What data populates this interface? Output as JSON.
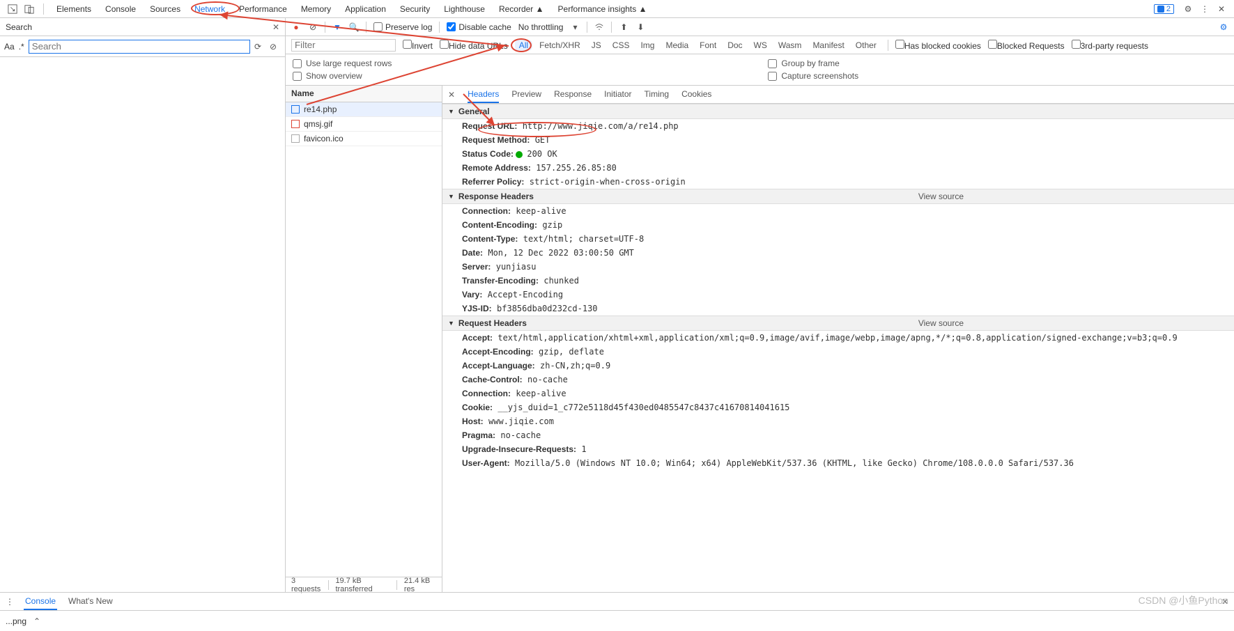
{
  "topTabs": {
    "items": [
      "Elements",
      "Console",
      "Sources",
      "Network",
      "Performance",
      "Memory",
      "Application",
      "Security",
      "Lighthouse",
      "Recorder ▲",
      "Performance insights ▲"
    ],
    "selected": "Network",
    "issuesBadge": "2"
  },
  "leftSearch": {
    "title": "Search",
    "placeholder": "Search",
    "aa": "Aa",
    "regex": ".*"
  },
  "toolbar": {
    "preserveLog": "Preserve log",
    "disableCache": "Disable cache",
    "throttling": "No throttling"
  },
  "filterBar": {
    "placeholder": "Filter",
    "invert": "Invert",
    "hideData": "Hide data URLs",
    "chips": [
      "All",
      "Fetch/XHR",
      "JS",
      "CSS",
      "Img",
      "Media",
      "Font",
      "Doc",
      "WS",
      "Wasm",
      "Manifest",
      "Other"
    ],
    "selected": "All",
    "blockedCookies": "Has blocked cookies",
    "blockedReq": "Blocked Requests",
    "thirdParty": "3rd-party requests"
  },
  "checkrow": {
    "largeRows": "Use large request rows",
    "overview": "Show overview",
    "groupFrame": "Group by frame",
    "capture": "Capture screenshots"
  },
  "reqlist": {
    "header": "Name",
    "items": [
      {
        "name": "re14.php",
        "type": "doc",
        "selected": true
      },
      {
        "name": "qmsj.gif",
        "type": "img",
        "selected": false
      },
      {
        "name": "favicon.ico",
        "type": "other",
        "selected": false
      }
    ]
  },
  "status": {
    "requests": "3 requests",
    "transferred": "19.7 kB transferred",
    "resources": "21.4 kB res"
  },
  "detailTabs": {
    "items": [
      "Headers",
      "Preview",
      "Response",
      "Initiator",
      "Timing",
      "Cookies"
    ],
    "selected": "Headers"
  },
  "general": {
    "title": "General",
    "rows": [
      {
        "k": "Request URL:",
        "v": "http://www.jiqie.com/a/re14.php"
      },
      {
        "k": "Request Method:",
        "v": "GET"
      },
      {
        "k": "Status Code:",
        "v": "200 OK",
        "dot": true
      },
      {
        "k": "Remote Address:",
        "v": "157.255.26.85:80"
      },
      {
        "k": "Referrer Policy:",
        "v": "strict-origin-when-cross-origin"
      }
    ]
  },
  "response": {
    "title": "Response Headers",
    "viewSource": "View source",
    "rows": [
      {
        "k": "Connection:",
        "v": "keep-alive"
      },
      {
        "k": "Content-Encoding:",
        "v": "gzip"
      },
      {
        "k": "Content-Type:",
        "v": "text/html; charset=UTF-8"
      },
      {
        "k": "Date:",
        "v": "Mon, 12 Dec 2022 03:00:50 GMT"
      },
      {
        "k": "Server:",
        "v": "yunjiasu"
      },
      {
        "k": "Transfer-Encoding:",
        "v": "chunked"
      },
      {
        "k": "Vary:",
        "v": "Accept-Encoding"
      },
      {
        "k": "YJS-ID:",
        "v": "bf3856dba0d232cd-130"
      }
    ]
  },
  "request": {
    "title": "Request Headers",
    "viewSource": "View source",
    "rows": [
      {
        "k": "Accept:",
        "v": "text/html,application/xhtml+xml,application/xml;q=0.9,image/avif,image/webp,image/apng,*/*;q=0.8,application/signed-exchange;v=b3;q=0.9"
      },
      {
        "k": "Accept-Encoding:",
        "v": "gzip, deflate"
      },
      {
        "k": "Accept-Language:",
        "v": "zh-CN,zh;q=0.9"
      },
      {
        "k": "Cache-Control:",
        "v": "no-cache"
      },
      {
        "k": "Connection:",
        "v": "keep-alive"
      },
      {
        "k": "Cookie:",
        "v": "__yjs_duid=1_c772e5118d45f430ed0485547c8437c41670814041615"
      },
      {
        "k": "Host:",
        "v": "www.jiqie.com"
      },
      {
        "k": "Pragma:",
        "v": "no-cache"
      },
      {
        "k": "Upgrade-Insecure-Requests:",
        "v": "1"
      },
      {
        "k": "User-Agent:",
        "v": "Mozilla/5.0 (Windows NT 10.0; Win64; x64) AppleWebKit/537.36 (KHTML, like Gecko) Chrome/108.0.0.0 Safari/537.36"
      }
    ]
  },
  "bottomTabs": {
    "items": [
      "Console",
      "What's New"
    ],
    "selected": "Console"
  },
  "dlbar": {
    "file": "...png"
  },
  "watermark": "CSDN @小鱼Python"
}
